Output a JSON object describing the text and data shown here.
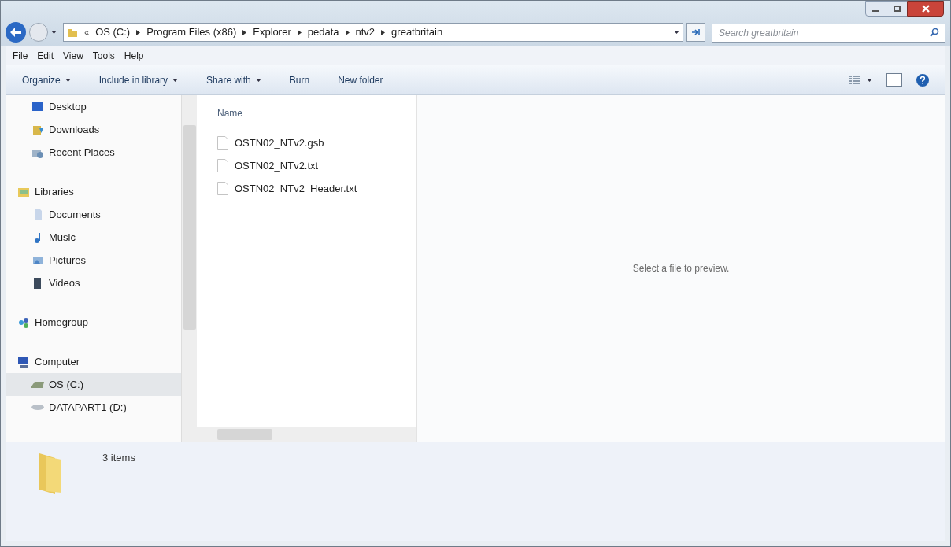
{
  "address_bar": {
    "overflow": "«",
    "crumbs": [
      "OS (C:)",
      "Program Files (x86)",
      "Explorer",
      "pedata",
      "ntv2",
      "greatbritain"
    ]
  },
  "search": {
    "placeholder": "Search greatbritain"
  },
  "menu": [
    "File",
    "Edit",
    "View",
    "Tools",
    "Help"
  ],
  "toolbar": [
    {
      "label": "Organize",
      "dropdown": true
    },
    {
      "label": "Include in library",
      "dropdown": true
    },
    {
      "label": "Share with",
      "dropdown": true
    },
    {
      "label": "Burn",
      "dropdown": false
    },
    {
      "label": "New folder",
      "dropdown": false
    }
  ],
  "nav_groups": [
    {
      "children": [
        {
          "label": "Desktop",
          "kind": "desktop",
          "selected": false
        },
        {
          "label": "Downloads",
          "kind": "downloads",
          "selected": false
        },
        {
          "label": "Recent Places",
          "kind": "recent",
          "selected": false
        }
      ]
    },
    {
      "label": "Libraries",
      "kind": "libraries",
      "children": [
        {
          "label": "Documents",
          "kind": "documents",
          "selected": false
        },
        {
          "label": "Music",
          "kind": "music",
          "selected": false
        },
        {
          "label": "Pictures",
          "kind": "pictures",
          "selected": false
        },
        {
          "label": "Videos",
          "kind": "videos",
          "selected": false
        }
      ]
    },
    {
      "label": "Homegroup",
      "kind": "homegroup"
    },
    {
      "label": "Computer",
      "kind": "computer",
      "children": [
        {
          "label": "OS (C:)",
          "kind": "drive",
          "selected": true
        },
        {
          "label": "DATAPART1 (D:)",
          "kind": "disk",
          "selected": false
        }
      ]
    }
  ],
  "file_list": {
    "column": "Name",
    "files": [
      {
        "name": "OSTN02_NTv2.gsb"
      },
      {
        "name": "OSTN02_NTv2.txt"
      },
      {
        "name": "OSTN02_NTv2_Header.txt"
      }
    ]
  },
  "preview": {
    "message": "Select a file to preview."
  },
  "status_bar": {
    "count": "3 items"
  }
}
